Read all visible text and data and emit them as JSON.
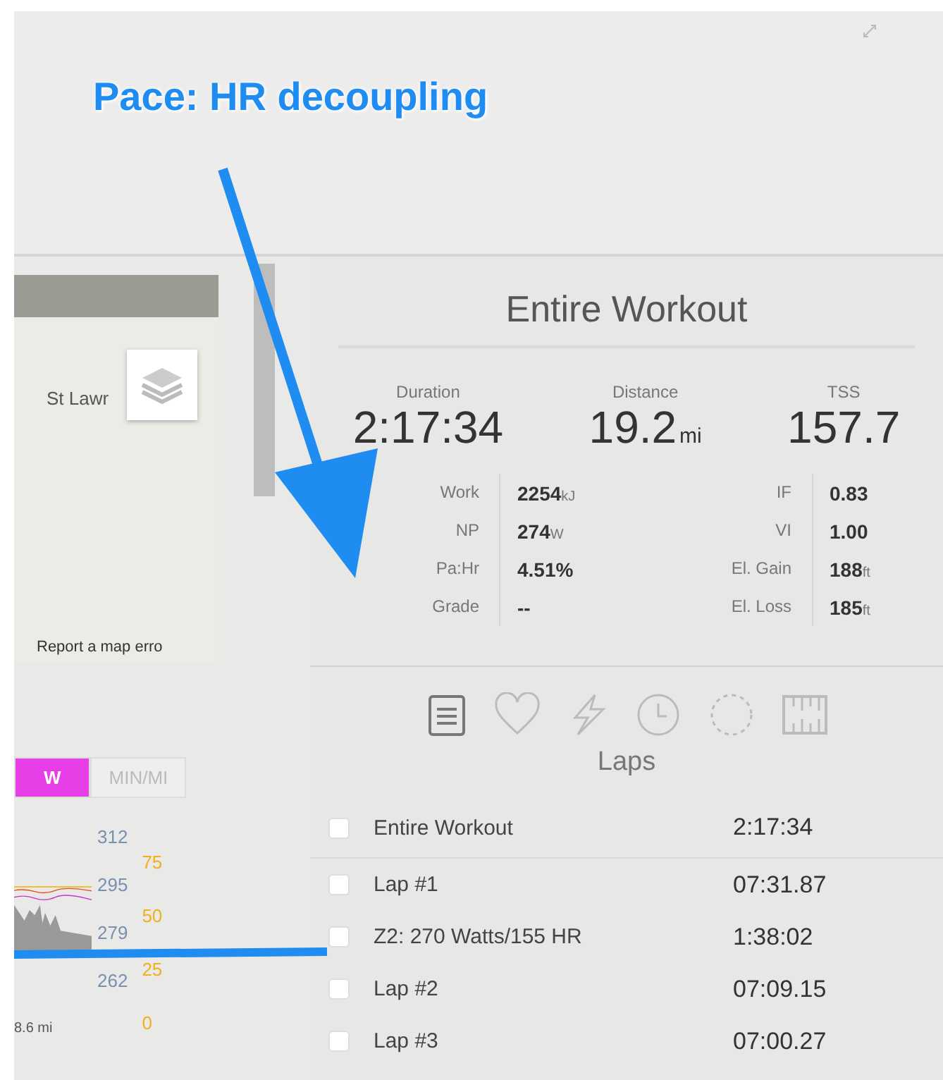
{
  "annotation": {
    "title": "Pace: HR decoupling"
  },
  "map": {
    "place_label": "St Lawr",
    "report_link": "Report a map erro"
  },
  "unit_toggle": [
    {
      "label": "W",
      "selected": true
    },
    {
      "label": "MIN/MI",
      "selected": false
    }
  ],
  "chart": {
    "left_axis": [
      "312",
      "295",
      "279",
      "262"
    ],
    "right_axis": [
      "75",
      "50",
      "25",
      "0"
    ],
    "x_label": "8.6 mi"
  },
  "summary": {
    "title": "Entire Workout",
    "stats": [
      {
        "label": "Duration",
        "value": "2:17:34"
      },
      {
        "label": "Distance",
        "value": "19.2",
        "unit": "mi"
      },
      {
        "label": "TSS",
        "value": "157.7"
      }
    ],
    "metrics_left": [
      {
        "label": "Work",
        "value": "2254",
        "unit": "kJ"
      },
      {
        "label": "NP",
        "value": "274",
        "unit": "W"
      },
      {
        "label": "Pa:Hr",
        "value": "4.51%"
      },
      {
        "label": "Grade",
        "value": "--"
      }
    ],
    "metrics_right": [
      {
        "label": "IF",
        "value": "0.83"
      },
      {
        "label": "VI",
        "value": "1.00"
      },
      {
        "label": "El. Gain",
        "value": "188",
        "unit": "ft"
      },
      {
        "label": "El. Loss",
        "value": "185",
        "unit": "ft"
      }
    ]
  },
  "view_tabs": [
    {
      "kind": "clipboard",
      "selected": true
    },
    {
      "kind": "heart",
      "selected": false
    },
    {
      "kind": "bolt",
      "selected": false
    },
    {
      "kind": "clock",
      "selected": false
    },
    {
      "kind": "dashed-circle",
      "selected": false
    },
    {
      "kind": "ruler",
      "selected": false
    }
  ],
  "laps": {
    "title": "Laps",
    "rows": [
      {
        "name": "Entire Workout",
        "time": "2:17:34",
        "checked": false
      },
      {
        "name": "Lap #1",
        "time": "07:31.87",
        "checked": false
      },
      {
        "name": "Z2: 270 Watts/155 HR",
        "time": "1:38:02",
        "checked": false
      },
      {
        "name": "Lap #2",
        "time": "07:09.15",
        "checked": false
      },
      {
        "name": "Lap #3",
        "time": "07:00.27",
        "checked": false
      }
    ]
  }
}
